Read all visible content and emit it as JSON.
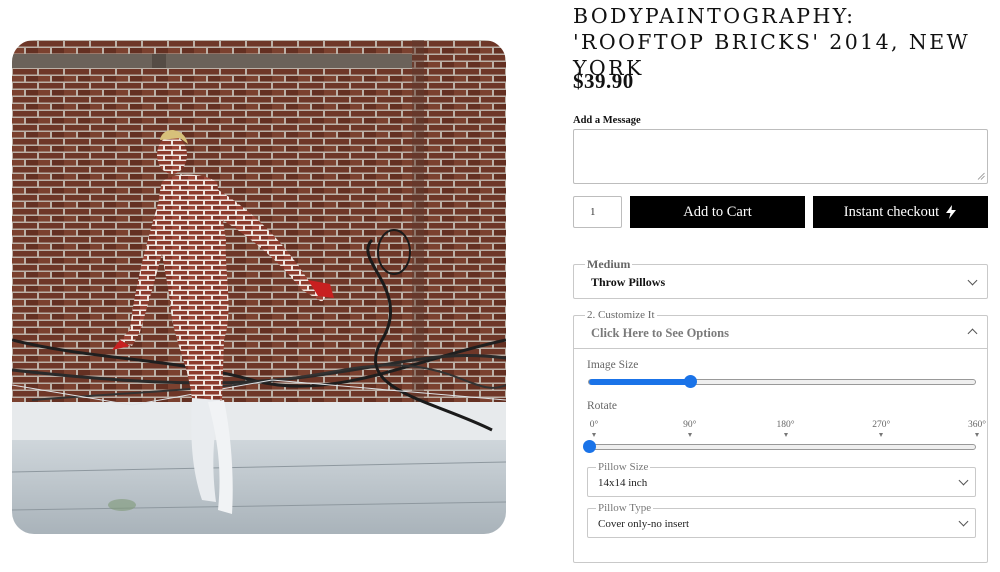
{
  "product": {
    "title": "BODYPAINTOGRAPHY: 'ROOFTOP BRICKS' 2014, NEW YORK",
    "price": "$39.90"
  },
  "message": {
    "label": "Add a Message",
    "value": ""
  },
  "quantity": {
    "value": "1"
  },
  "buttons": {
    "add_to_cart": "Add to Cart",
    "instant_checkout": "Instant checkout"
  },
  "medium": {
    "legend": "Medium",
    "selected": "Throw Pillows"
  },
  "customize": {
    "legend": "2. Customize It",
    "header": "Click Here to See Options",
    "image_size": {
      "label": "Image Size",
      "value": 0.26
    },
    "rotate": {
      "label": "Rotate",
      "ticks": [
        "0°",
        "90°",
        "180°",
        "270°",
        "360°"
      ],
      "value": 0
    },
    "pillow_size": {
      "legend": "Pillow Size",
      "selected": "14x14 inch"
    },
    "pillow_type": {
      "legend": "Pillow Type",
      "selected": "Cover only-no insert"
    }
  },
  "icons": {
    "instant_checkout": "lightning-bolt-icon",
    "dropdown": "chevron-down-icon",
    "collapse": "chevron-up-icon"
  },
  "colors": {
    "button_bg": "#000000",
    "slider_accent": "#1a73e8"
  }
}
